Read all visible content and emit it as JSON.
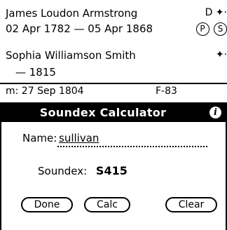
{
  "records": [
    {
      "name": "James Loudon Armstrong",
      "dates": "02 Apr 1782 — 05 Apr 1868"
    },
    {
      "name": "Sophia Williamson Smith",
      "dates": "— 1815"
    }
  ],
  "icons": {
    "row1_right": "D ✦·",
    "p": "P",
    "s": "S",
    "row2_right": "✦·"
  },
  "marriage": {
    "label": "m:  27 Sep 1804",
    "code": "F-83"
  },
  "dialog": {
    "title": "Soundex Calculator",
    "info_glyph": "i",
    "name_label": "Name:",
    "name_value": "sullivan",
    "soundex_label": "Soundex:",
    "soundex_value": "S415",
    "buttons": {
      "done": "Done",
      "calc": "Calc",
      "clear": "Clear"
    }
  }
}
